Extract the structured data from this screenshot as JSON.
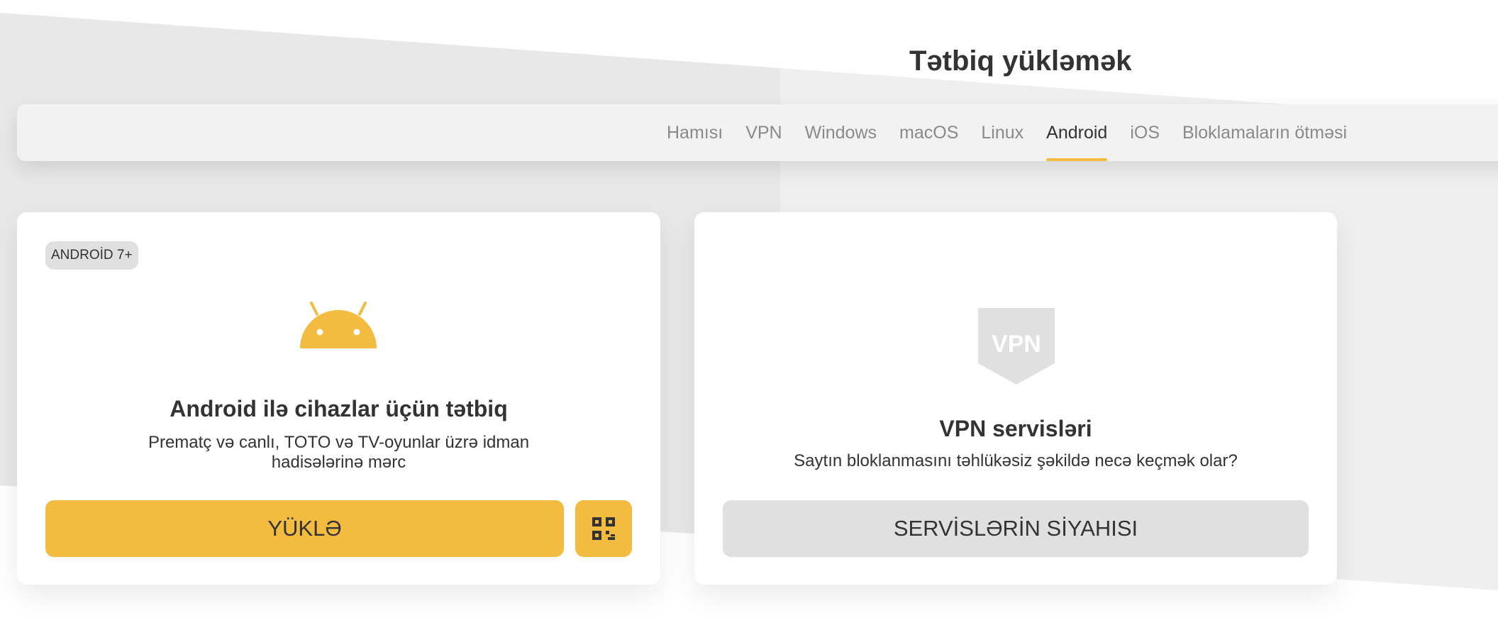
{
  "page": {
    "title": "Tətbiq yükləmək"
  },
  "tabs": [
    {
      "label": "Hamısı",
      "active": false
    },
    {
      "label": "VPN",
      "active": false
    },
    {
      "label": "Windows",
      "active": false
    },
    {
      "label": "macOS",
      "active": false
    },
    {
      "label": "Linux",
      "active": false
    },
    {
      "label": "Android",
      "active": true
    },
    {
      "label": "iOS",
      "active": false
    },
    {
      "label": "Bloklamaların ötməsi",
      "active": false
    }
  ],
  "cards": {
    "android": {
      "badge": "ANDROİD 7+",
      "icon": "android-icon",
      "title": "Android ilə cihazlar üçün tətbiq",
      "description": "Prematç və canlı, TOTO və TV-oyunlar üzrə idman hadisələrinə mərc",
      "button_label": "YÜKLƏ",
      "qr_icon": "qr-code-icon"
    },
    "vpn": {
      "icon": "vpn-shield-icon",
      "icon_text": "VPN",
      "title": "VPN servisləri",
      "description": "Saytın bloklanmasını təhlükəsiz şəkildə necə keçmək olar?",
      "button_label": "SERVİSLƏRİN SİYAHISI"
    }
  },
  "colors": {
    "accent": "#f3bc41",
    "text": "#333333",
    "muted": "#8a8a8a",
    "surface": "#f2f2f2",
    "secondary_button": "#e0e0e0"
  }
}
